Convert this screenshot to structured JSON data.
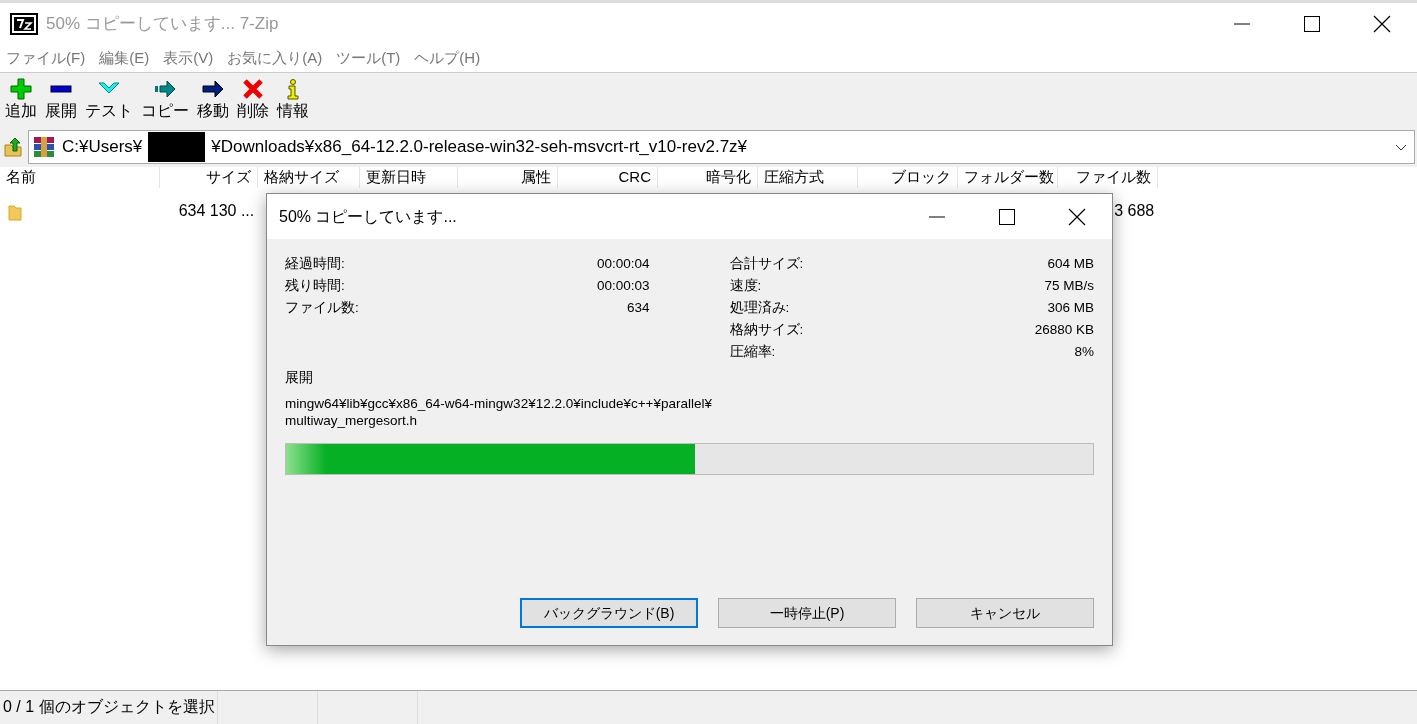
{
  "window": {
    "title": "50% コピーしています... 7-Zip"
  },
  "menu": [
    "ファイル(F)",
    "編集(E)",
    "表示(V)",
    "お気に入り(A)",
    "ツール(T)",
    "ヘルプ(H)"
  ],
  "toolbar": [
    {
      "label": "追加",
      "kind": "add"
    },
    {
      "label": "展開",
      "kind": "extract"
    },
    {
      "label": "テスト",
      "kind": "test"
    },
    {
      "label": "コピー",
      "kind": "copy"
    },
    {
      "label": "移動",
      "kind": "move"
    },
    {
      "label": "削除",
      "kind": "delete"
    },
    {
      "label": "情報",
      "kind": "info"
    }
  ],
  "address": {
    "path_start": "C:¥Users¥",
    "redacted": true,
    "path_end": "¥Downloads¥x86_64-12.2.0-release-win32-seh-msvcrt-rt_v10-rev2.7z¥"
  },
  "file_list": {
    "columns": [
      {
        "label": "名前"
      },
      {
        "label": "サイズ"
      },
      {
        "label": "格納サイズ"
      },
      {
        "label": "更新日時"
      },
      {
        "label": "属性"
      },
      {
        "label": "CRC"
      },
      {
        "label": "暗号化"
      },
      {
        "label": "圧縮方式"
      },
      {
        "label": "ブロック"
      },
      {
        "label": "フォルダー数"
      },
      {
        "label": "ファイル数"
      }
    ],
    "rows": [
      {
        "kind": "folder",
        "size": "634 130 ...",
        "file_count": "3 688"
      }
    ]
  },
  "status_bar": [
    "0 / 1 個のオブジェクトを選択"
  ],
  "dialog": {
    "title": "50% コピーしています...",
    "stats_left": [
      {
        "label": "経過時間:",
        "value": "00:00:04"
      },
      {
        "label": "残り時間:",
        "value": "00:00:03"
      },
      {
        "label": "ファイル数:",
        "value": "634"
      }
    ],
    "stats_right": [
      {
        "label": "合計サイズ:",
        "value": "604 MB"
      },
      {
        "label": "速度:",
        "value": "75 MB/s"
      },
      {
        "label": "処理済み:",
        "value": "306 MB"
      },
      {
        "label": "格納サイズ:",
        "value": "26880 KB"
      },
      {
        "label": "圧縮率:",
        "value": "8%"
      }
    ],
    "operation": "展開",
    "current_file_lines": [
      "mingw64¥lib¥gcc¥x86_64-w64-mingw32¥12.2.0¥include¥c++¥parallel¥",
      "multiway_mergesort.h"
    ],
    "progress": {
      "level": 0.507
    },
    "buttons": [
      {
        "label": "バックグラウンド(B)",
        "focused": true
      },
      {
        "label": "一時停止(P)",
        "focused": false
      },
      {
        "label": "キャンセル",
        "focused": false
      }
    ]
  }
}
